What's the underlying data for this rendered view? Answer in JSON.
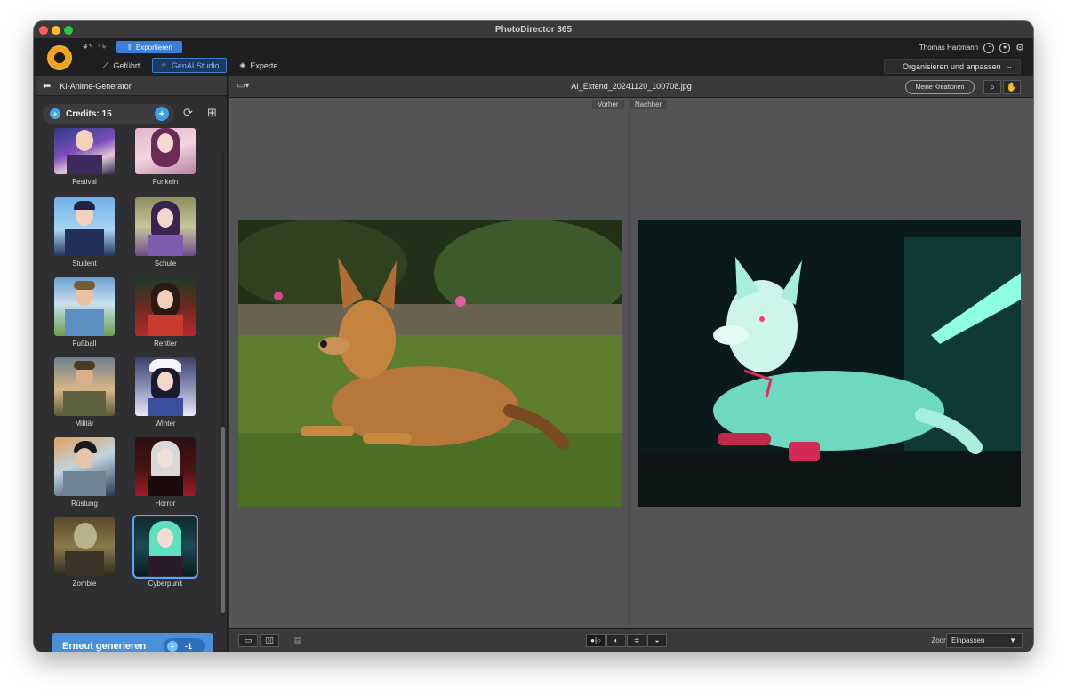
{
  "window": {
    "title": "PhotoDirector 365"
  },
  "topbar": {
    "export_label": "Exportieren",
    "user_name": "Thomas Hartmann",
    "organize_label": "Organisieren und anpassen",
    "modes": [
      {
        "label": "Geführt",
        "icon": "magic-wand-icon"
      },
      {
        "label": "GenAI Studio",
        "icon": "sparkle-icon"
      },
      {
        "label": "Experte",
        "icon": "layers-icon"
      }
    ]
  },
  "sidebar": {
    "title": "KI-Anime-Generator",
    "credits_label": "Credits: 15",
    "styles": [
      {
        "label": "Festival"
      },
      {
        "label": "Funkeln"
      },
      {
        "label": "Student"
      },
      {
        "label": "Schule"
      },
      {
        "label": "Fußball"
      },
      {
        "label": "Rentier"
      },
      {
        "label": "Militär"
      },
      {
        "label": "Winter"
      },
      {
        "label": "Rüstung"
      },
      {
        "label": "Horror"
      },
      {
        "label": "Zombie"
      },
      {
        "label": "Cyberpunk"
      }
    ],
    "selected_style": "Cyberpunk",
    "regenerate_label": "Erneut generieren",
    "regenerate_cost": "-1"
  },
  "main": {
    "filename": "AI_Extend_20241120_100708.jpg",
    "creations_label": "Meine Kreationen",
    "before_label": "Vorher",
    "after_label": "Nachher",
    "zoom_label": "Zoom:",
    "zoom_value": "Einpassen"
  }
}
